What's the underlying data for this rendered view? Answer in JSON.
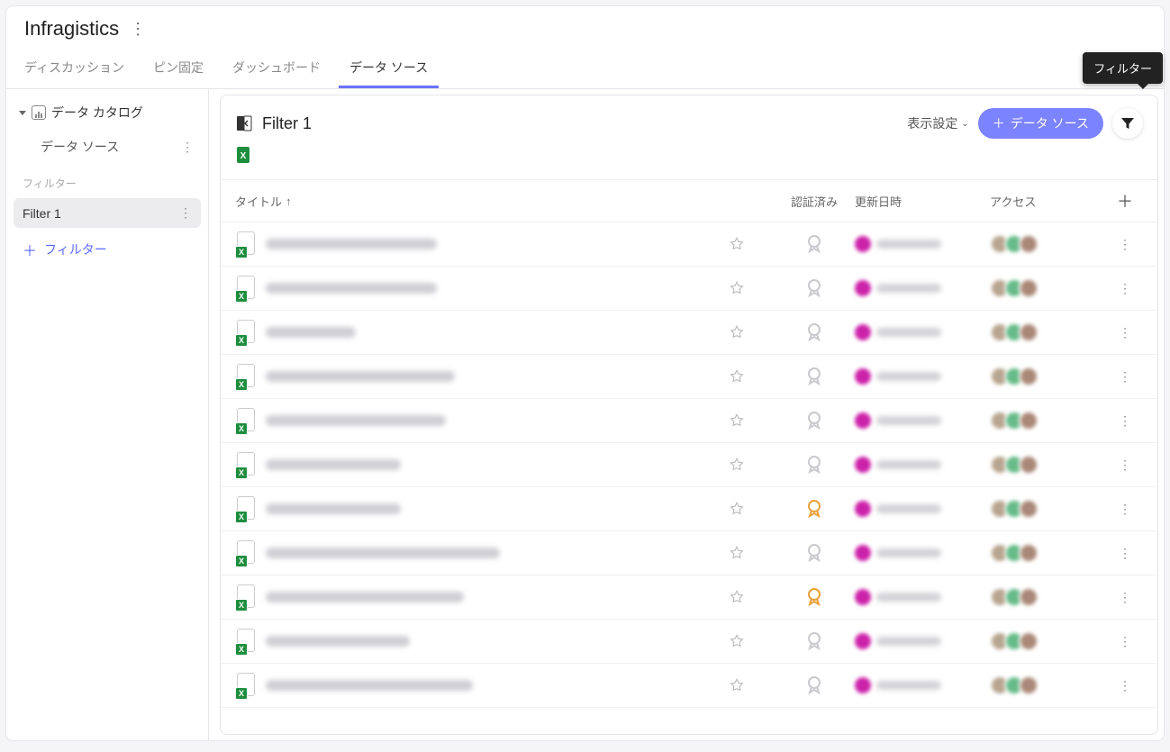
{
  "brand": "Infragistics",
  "tabs": [
    {
      "label": "ディスカッション",
      "active": false
    },
    {
      "label": "ピン固定",
      "active": false
    },
    {
      "label": "ダッシュボード",
      "active": false
    },
    {
      "label": "データ ソース",
      "active": true
    }
  ],
  "sidebar": {
    "catalog_label": "データ カタログ",
    "datasource_label": "データ ソース",
    "filter_section_label": "フィルター",
    "items": [
      {
        "label": "Filter 1",
        "selected": true
      }
    ],
    "add_filter_label": "フィルター"
  },
  "main": {
    "title": "Filter 1",
    "display_settings_label": "表示設定",
    "add_button_label": "データ ソース",
    "tooltip": "フィルター",
    "columns": {
      "title": "タイトル",
      "certified": "認証済み",
      "updated": "更新日時",
      "access": "アクセス"
    },
    "rows": [
      {
        "title_width": 190,
        "cert": "grey"
      },
      {
        "title_width": 190,
        "cert": "grey"
      },
      {
        "title_width": 100,
        "cert": "grey"
      },
      {
        "title_width": 210,
        "cert": "grey"
      },
      {
        "title_width": 200,
        "cert": "grey"
      },
      {
        "title_width": 150,
        "cert": "grey"
      },
      {
        "title_width": 150,
        "cert": "orange"
      },
      {
        "title_width": 260,
        "cert": "grey"
      },
      {
        "title_width": 220,
        "cert": "orange"
      },
      {
        "title_width": 160,
        "cert": "grey"
      },
      {
        "title_width": 230,
        "cert": "grey"
      }
    ]
  },
  "icons": {
    "excel": "X"
  }
}
